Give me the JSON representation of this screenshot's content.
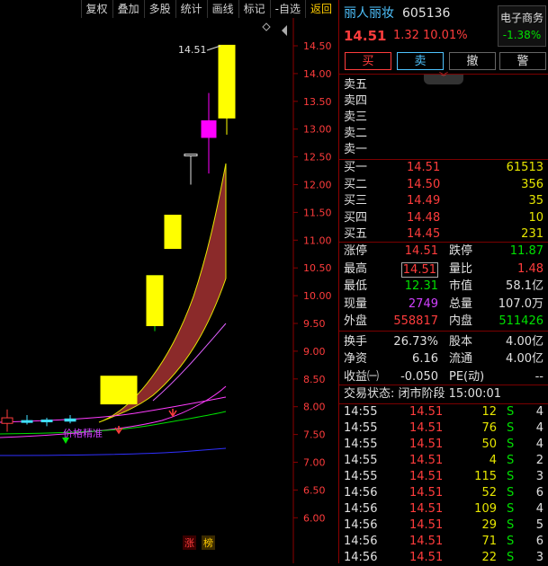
{
  "toolbar": {
    "items": [
      "复权",
      "叠加",
      "多股",
      "统计",
      "画线",
      "标记",
      "-自选",
      "返回"
    ]
  },
  "chart": {
    "price_ticks": [
      "14.50",
      "14.00",
      "13.50",
      "13.00",
      "12.50",
      "12.00",
      "11.50",
      "11.00",
      "10.50",
      "10.00",
      "9.50",
      "9.00",
      "8.50",
      "8.00",
      "7.50",
      "7.00",
      "6.50",
      "6.00"
    ],
    "high_label": "14.51",
    "bottom_badges": [
      "涨",
      "榜"
    ],
    "annotation_text": "价格精准"
  },
  "chart_data": {
    "type": "candlestick",
    "y_axis_range": [
      5.8,
      14.8
    ],
    "candles": [
      {
        "o": 7.7,
        "h": 7.95,
        "l": 7.55,
        "c": 7.8,
        "color": "red"
      },
      {
        "o": 7.75,
        "h": 7.85,
        "l": 7.68,
        "c": 7.72,
        "color": "cyan"
      },
      {
        "o": 7.74,
        "h": 7.8,
        "l": 7.65,
        "c": 7.76,
        "color": "cyan"
      },
      {
        "o": 7.78,
        "h": 7.85,
        "l": 7.7,
        "c": 7.74,
        "color": "cyan"
      },
      {
        "o": 8.05,
        "h": 8.55,
        "l": 8.05,
        "c": 8.55,
        "color": "yellow"
      },
      {
        "o": 10.36,
        "h": 10.36,
        "l": 9.36,
        "c": 9.46,
        "color": "green"
      },
      {
        "o": 9.46,
        "h": 10.36,
        "l": 9.46,
        "c": 10.36,
        "color": "yellow"
      },
      {
        "o": 11.45,
        "h": 11.45,
        "l": 10.85,
        "c": 10.85,
        "color": "yellow"
      },
      {
        "o": 12.55,
        "h": 12.55,
        "l": 12.0,
        "c": 12.55,
        "color": "white"
      },
      {
        "o": 12.85,
        "h": 13.65,
        "l": 12.2,
        "c": 13.15,
        "color": "magenta"
      },
      {
        "o": 14.51,
        "h": 14.51,
        "l": 12.9,
        "c": 13.2,
        "color": "yellow"
      }
    ]
  },
  "stock": {
    "name": "丽人丽妆",
    "code": "605136",
    "price": "14.51",
    "change": "1.32",
    "change_pct": "10.01%",
    "sector": "电子商务",
    "sector_pct": "-1.38%"
  },
  "buttons": [
    "买",
    "卖",
    "撤",
    "警"
  ],
  "asks": [
    {
      "label": "卖五",
      "price": "",
      "vol": ""
    },
    {
      "label": "卖四",
      "price": "",
      "vol": ""
    },
    {
      "label": "卖三",
      "price": "",
      "vol": ""
    },
    {
      "label": "卖二",
      "price": "",
      "vol": ""
    },
    {
      "label": "卖一",
      "price": "",
      "vol": ""
    }
  ],
  "bids": [
    {
      "label": "买一",
      "price": "14.51",
      "vol": "61513"
    },
    {
      "label": "买二",
      "price": "14.50",
      "vol": "356"
    },
    {
      "label": "买三",
      "price": "14.49",
      "vol": "35"
    },
    {
      "label": "买四",
      "price": "14.48",
      "vol": "10"
    },
    {
      "label": "买五",
      "price": "14.45",
      "vol": "231"
    }
  ],
  "stats": {
    "limit_up_label": "涨停",
    "limit_up": "14.51",
    "limit_down_label": "跌停",
    "limit_down": "11.87",
    "high_label": "最高",
    "high": "14.51",
    "vol_ratio_label": "量比",
    "vol_ratio": "1.48",
    "low_label": "最低",
    "low": "12.31",
    "mkt_cap_label": "市值",
    "mkt_cap": "58.1亿",
    "cur_vol_label": "现量",
    "cur_vol": "2749",
    "total_vol_label": "总量",
    "total_vol": "107.0万",
    "outer_label": "外盘",
    "outer": "558817",
    "inner_label": "内盘",
    "inner": "511426",
    "turnover_label": "换手",
    "turnover": "26.73%",
    "equity_label": "股本",
    "equity": "4.00亿",
    "nav_label": "净资",
    "nav": "6.16",
    "float_label": "流通",
    "float": "4.00亿",
    "eps_label": "收益㈠",
    "eps": "-0.050",
    "pe_label": "PE(动)",
    "pe": "--"
  },
  "trade_status": "交易状态: 闭市阶段 15:00:01",
  "ticks": [
    {
      "time": "14:55",
      "price": "14.51",
      "vol": "12",
      "side": "S",
      "n": "4"
    },
    {
      "time": "14:55",
      "price": "14.51",
      "vol": "76",
      "side": "S",
      "n": "4"
    },
    {
      "time": "14:55",
      "price": "14.51",
      "vol": "50",
      "side": "S",
      "n": "4"
    },
    {
      "time": "14:55",
      "price": "14.51",
      "vol": "4",
      "side": "S",
      "n": "2"
    },
    {
      "time": "14:55",
      "price": "14.51",
      "vol": "115",
      "side": "S",
      "n": "3"
    },
    {
      "time": "14:56",
      "price": "14.51",
      "vol": "52",
      "side": "S",
      "n": "6"
    },
    {
      "time": "14:56",
      "price": "14.51",
      "vol": "109",
      "side": "S",
      "n": "4"
    },
    {
      "time": "14:56",
      "price": "14.51",
      "vol": "29",
      "side": "S",
      "n": "5"
    },
    {
      "time": "14:56",
      "price": "14.51",
      "vol": "71",
      "side": "S",
      "n": "6"
    },
    {
      "time": "14:56",
      "price": "14.51",
      "vol": "22",
      "side": "S",
      "n": "3"
    }
  ],
  "colors": {
    "up": "#ff3c3c",
    "down": "#00e000",
    "neutral": "#e6e600",
    "frame": "#8b0000"
  }
}
